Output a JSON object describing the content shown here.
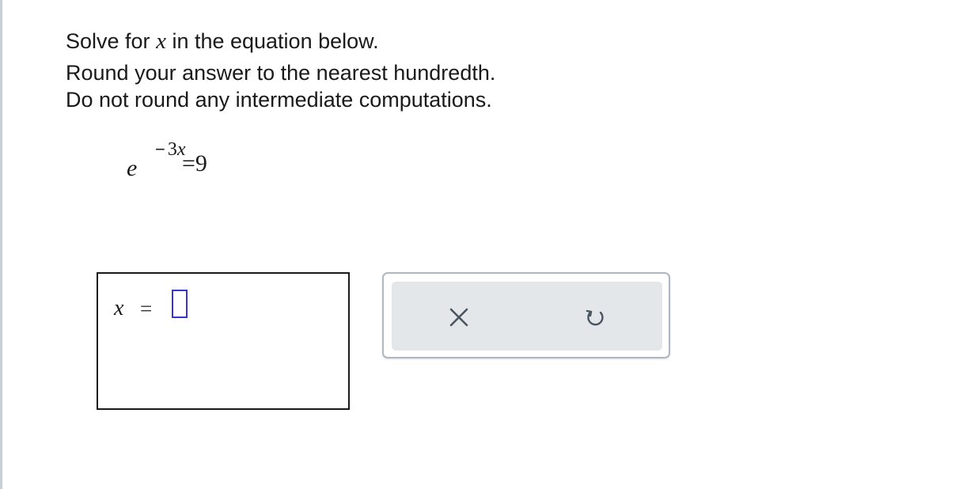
{
  "instructions": {
    "line1_prefix": "Solve for ",
    "line1_var": "x",
    "line1_suffix": " in the equation below.",
    "line2": "Round your answer to the nearest hundredth.",
    "line3": "Do not round any intermediate computations."
  },
  "equation": {
    "base": "e",
    "exponent_sign": "−",
    "exponent_coef": "3",
    "exponent_var": "x",
    "rhs": "=9"
  },
  "answer": {
    "variable": "x",
    "equals": "=",
    "value": ""
  },
  "tools": {
    "clear_icon": "close-icon",
    "undo_icon": "undo-icon",
    "icon_color": "#4a5560"
  },
  "colors": {
    "input_border": "#3a36d6",
    "panel_border": "#aeb8c2",
    "panel_fill": "#e3e7ea"
  }
}
